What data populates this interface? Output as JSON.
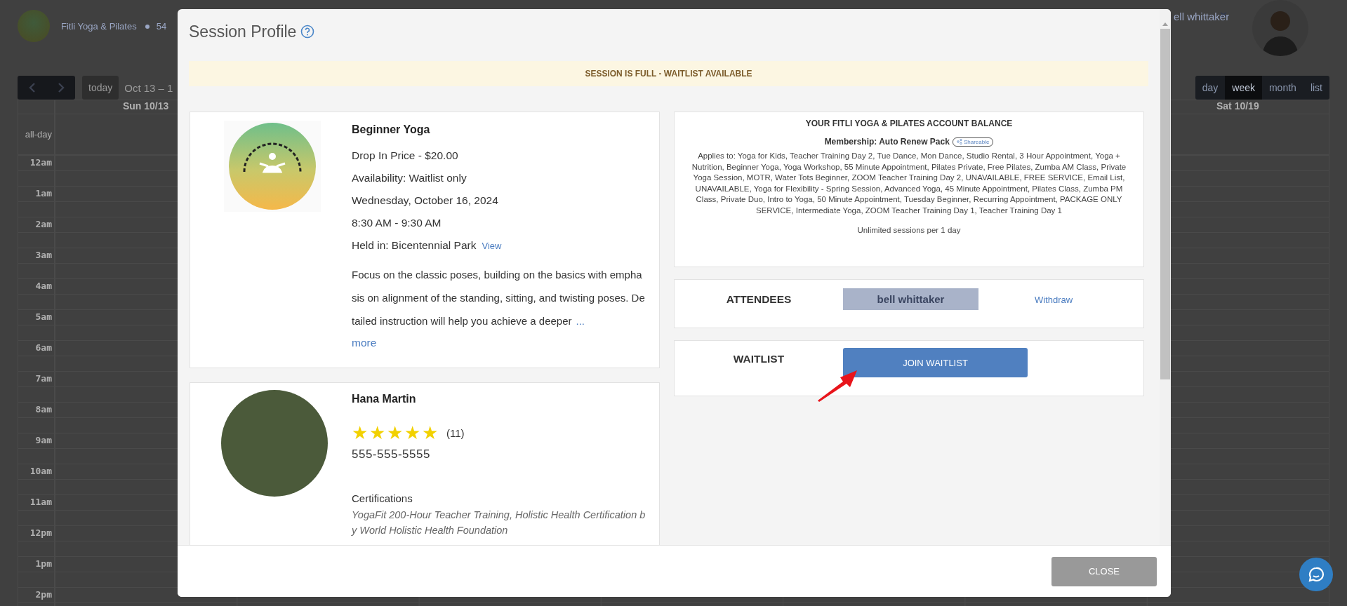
{
  "header": {
    "business_name": "Fitli Yoga & Pilates",
    "address_start": "54",
    "user_name": "ell whittaker"
  },
  "calendar": {
    "today_button": "today",
    "date_range": "Oct 13 – 1",
    "views": [
      {
        "label": "day",
        "selected": false
      },
      {
        "label": "week",
        "selected": true
      },
      {
        "label": "month",
        "selected": false
      },
      {
        "label": "list",
        "selected": false
      }
    ],
    "first_day": "Sun 10/13",
    "last_day": "Sat 10/19",
    "all_day_label": "all-day",
    "hours": [
      "12am",
      "1am",
      "2am",
      "3am",
      "4am",
      "5am",
      "6am",
      "7am",
      "8am",
      "9am",
      "10am",
      "11am",
      "12pm",
      "1pm",
      "2pm"
    ]
  },
  "modal": {
    "title": "Session Profile",
    "banner": "SESSION IS FULL - WAITLIST AVAILABLE",
    "session": {
      "name": "Beginner Yoga",
      "price": "Drop In Price - $20.00",
      "availability": "Availability: Waitlist only",
      "date": "Wednesday, October 16, 2024",
      "time": "8:30 AM - 9:30 AM",
      "location": "Held in: Bicentennial Park",
      "location_link": "View",
      "description": "Focus on the classic poses, building on the basics with emphasis on alignment of the standing, sitting, and twisting poses. Detailed instruction will help you achieve a deeper",
      "ellipsis": "...",
      "more_link": "more"
    },
    "instructor": {
      "name": "Hana Martin",
      "stars": 5,
      "rating_count": "(11)",
      "phone": "555-555-5555",
      "certifications_label": "Certifications",
      "certifications": "YogaFit 200-Hour Teacher Training, Holistic Health Certification by World Holistic Health Foundation"
    },
    "balance": {
      "title": "YOUR FITLI YOGA & PILATES ACCOUNT BALANCE",
      "membership": "Membership: Auto Renew Pack",
      "badge": "Shareable",
      "applies_to": "Applies to: Yoga for Kids, Teacher Training Day 2, Tue Dance, Mon Dance, Studio Rental, 3 Hour Appointment, Yoga + Nutrition, Beginner Yoga, Yoga Workshop, 55 Minute Appointment, Pilates Private, Free Pilates, Zumba AM Class, Private Yoga Session, MOTR, Water Tots Beginner, ZOOM Teacher Training Day 2, UNAVAILABLE, FREE SERVICE, Email List, UNAVAILABLE, Yoga for Flexibility - Spring Session, Advanced Yoga, 45 Minute Appointment, Pilates Class, Zumba PM Class, Private Duo, Intro to Yoga, 50 Minute Appointment, Tuesday Beginner, Recurring Appointment, PACKAGE ONLY SERVICE, Intermediate Yoga, ZOOM Teacher Training Day 1, Teacher Training Day 1",
      "limit": "Unlimited sessions per 1 day"
    },
    "attendees": {
      "label": "ATTENDEES",
      "names": [
        "bell whittaker"
      ],
      "withdraw_link": "Withdraw"
    },
    "waitlist": {
      "label": "WAITLIST",
      "button": "JOIN WAITLIST"
    },
    "close_button": "CLOSE"
  }
}
